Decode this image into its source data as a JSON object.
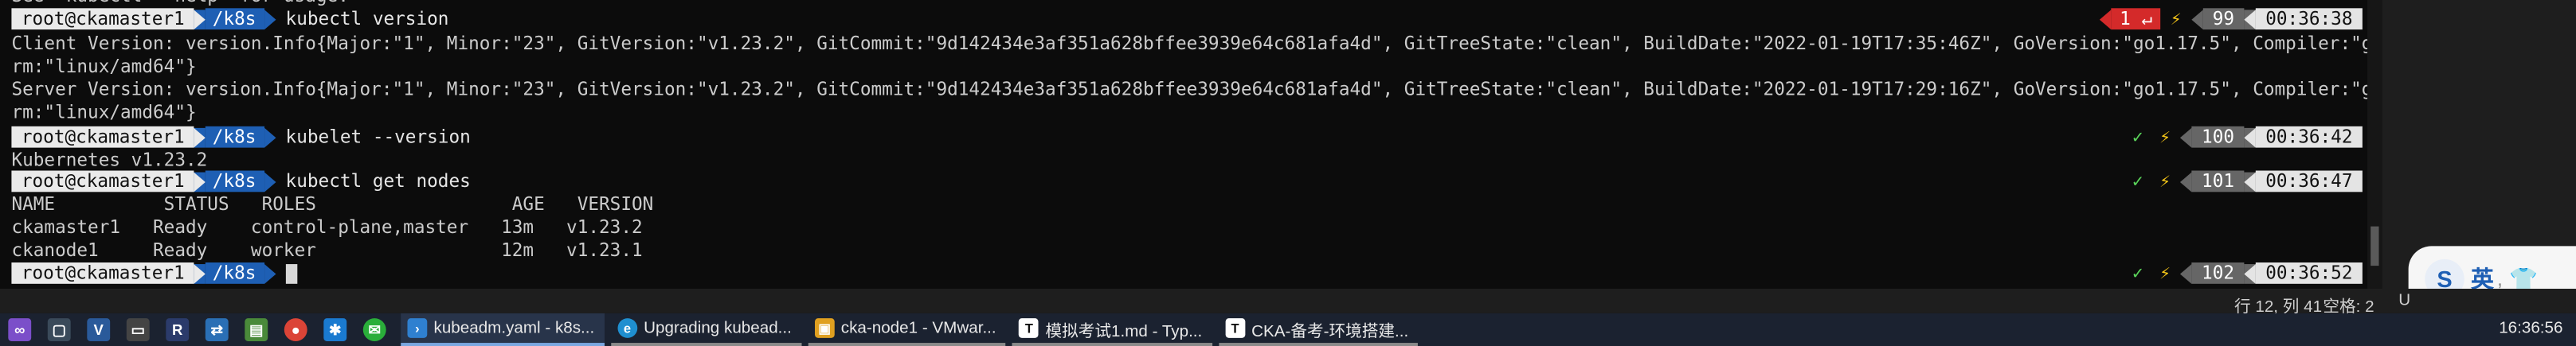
{
  "terminal": {
    "top_cut_line": "See 'kubectl --help' for usage.",
    "prompt": {
      "user": "root@ckamaster1",
      "dir": "/k8s"
    },
    "lines": [
      "Client Version: version.Info{Major:\"1\", Minor:\"23\", GitVersion:\"v1.23.2\", GitCommit:\"9d142434e3af351a628bffee3939e64c681afa4d\", GitTreeState:\"clean\", BuildDate:\"2022-01-19T17:35:46Z\", GoVersion:\"go1.17.5\", Compiler:\"gc\", Platfo",
      "rm:\"linux/amd64\"}",
      "Server Version: version.Info{Major:\"1\", Minor:\"23\", GitVersion:\"v1.23.2\", GitCommit:\"9d142434e3af351a628bffee3939e64c681afa4d\", GitTreeState:\"clean\", BuildDate:\"2022-01-19T17:29:16Z\", GoVersion:\"go1.17.5\", Compiler:\"gc\", Platfo",
      "rm:\"linux/amd64\"}",
      "Kubernetes v1.23.2",
      "NAME          STATUS   ROLES                  AGE   VERSION",
      "ckamaster1   Ready    control-plane,master   13m   v1.23.2",
      "ckanode1     Ready    worker                 12m   v1.23.1"
    ],
    "commands": [
      "kubectl version",
      "kubelet --version",
      "kubectl get nodes",
      ""
    ],
    "right_prompts": [
      {
        "status": "1",
        "hist": "99",
        "time": "00:36:38"
      },
      {
        "status": "✓",
        "hist": "100",
        "time": "00:36:42"
      },
      {
        "status": "✓",
        "hist": "101",
        "time": "00:36:47"
      },
      {
        "status": "✓",
        "hist": "102",
        "time": "00:36:52"
      }
    ],
    "colors": {
      "background": "#0c0c0c",
      "text": "#cccccc",
      "user_seg": "#eaeaea",
      "dir_seg": "#1e5fb4",
      "ok": "#5ad45a",
      "error_seg": "#d42a2a",
      "bolt": "#f5c518"
    }
  },
  "status_bar": {
    "position": "行 12, 列 41",
    "spaces": "空格: 2",
    "encoding": "U"
  },
  "ime": {
    "icon": "S",
    "label": "英"
  },
  "taskbar": {
    "pinned": [
      "visual-studio-icon",
      "app-icon-2",
      "vscode-alt-icon",
      "terminal-icon",
      "rdp-icon",
      "remote-icon",
      "notepad-icon",
      "chrome-icon",
      "star-app-icon",
      "wechat-icon"
    ],
    "apps": [
      {
        "label": "kubeadm.yaml - k8s...",
        "icon": "vscode-icon",
        "color": "#2f80d0"
      },
      {
        "label": "Upgrading kubead...",
        "icon": "edge-icon",
        "color": "#1f8fd0"
      },
      {
        "label": "cka-node1 - VMwar...",
        "icon": "vmware-icon",
        "color": "#e0a020"
      },
      {
        "label": "模拟考试1.md - Typ...",
        "icon": "typora-icon",
        "color": "#ffffff"
      },
      {
        "label": "CKA-备考-环境搭建...",
        "icon": "typora-icon",
        "color": "#ffffff"
      }
    ],
    "clock": "16:36:56"
  }
}
